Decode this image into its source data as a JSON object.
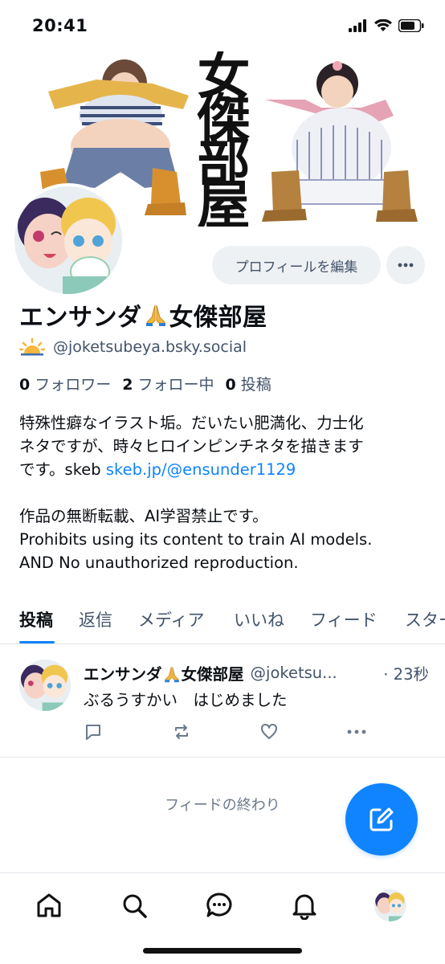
{
  "status_bar": {
    "time": "20:41"
  },
  "banner": {
    "title_chars": [
      "女",
      "傑",
      "部",
      "屋"
    ]
  },
  "profile": {
    "edit_label": "プロフィールを編集",
    "display_name": "エンサンダ",
    "display_name_suffix": "女傑部屋",
    "handle": "@joketsubeya.bsky.social",
    "stats": {
      "followers_count": "0",
      "followers_label": "フォロワー",
      "following_count": "2",
      "following_label": "フォロー中",
      "posts_count": "0",
      "posts_label": "投稿"
    },
    "bio": {
      "line1": "特殊性癖なイラスト垢。だいたい肥満化、力士化",
      "line2": "ネタですが、時々ヒロインピンチネタを描きます",
      "line3_prefix": "です。skeb ",
      "line3_link": "skeb.jp/@ensunder1129",
      "line4": "作品の無断転載、AI学習禁止です。",
      "line5": "Prohibits using its content to train AI models.",
      "line6": "AND No unauthorized reproduction."
    }
  },
  "tabs": [
    {
      "label": "投稿",
      "active": true
    },
    {
      "label": "返信"
    },
    {
      "label": "メディア"
    },
    {
      "label": "いいね"
    },
    {
      "label": "フィード"
    },
    {
      "label": "スタータ"
    }
  ],
  "post": {
    "author": "エンサンダ",
    "author_suffix": "女傑部屋",
    "handle": "@joketsu...",
    "time": "· 23秒",
    "text": "ぶるうすかい　はじめました"
  },
  "feed_end": "フィードの終わり",
  "colors": {
    "accent": "#1083fe",
    "muted": "#42536a",
    "border": "#e3e7eb"
  },
  "icons": {
    "status": [
      "signal-icon",
      "wifi-icon",
      "battery-icon"
    ],
    "post_actions": [
      "reply-icon",
      "repost-icon",
      "like-icon",
      "post-more-icon"
    ],
    "nav": [
      "home-icon",
      "search-icon",
      "chat-icon",
      "notifications-icon",
      "profile-avatar"
    ]
  }
}
